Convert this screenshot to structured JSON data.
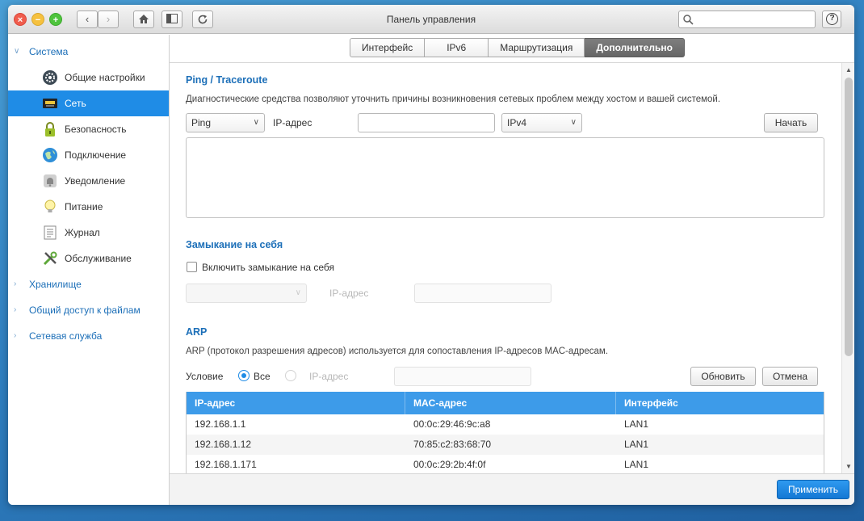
{
  "window": {
    "title": "Панель управления"
  },
  "toolbar": {
    "close_glyph": "×",
    "minimize_glyph": "−",
    "maximize_glyph": "+",
    "back_glyph": "‹",
    "forward_glyph": "›",
    "search_placeholder": "",
    "help_glyph": "?"
  },
  "sidebar": {
    "groups": [
      {
        "label": "Система",
        "expanded": true
      },
      {
        "label": "Хранилище",
        "expanded": false
      },
      {
        "label": "Общий доступ к файлам",
        "expanded": false
      },
      {
        "label": "Сетевая служба",
        "expanded": false
      }
    ],
    "items": [
      {
        "label": "Общие настройки",
        "icon": "settings-gear-icon"
      },
      {
        "label": "Сеть",
        "icon": "network-icon",
        "active": true
      },
      {
        "label": "Безопасность",
        "icon": "lock-icon"
      },
      {
        "label": "Подключение",
        "icon": "globe-icon"
      },
      {
        "label": "Уведомление",
        "icon": "bell-icon"
      },
      {
        "label": "Питание",
        "icon": "lightbulb-icon"
      },
      {
        "label": "Журнал",
        "icon": "log-icon"
      },
      {
        "label": "Обслуживание",
        "icon": "tools-icon"
      }
    ]
  },
  "tabs": [
    {
      "label": "Интерфейс"
    },
    {
      "label": "IPv6"
    },
    {
      "label": "Маршрутизация"
    },
    {
      "label": "Дополнительно",
      "active": true
    }
  ],
  "ping": {
    "title": "Ping / Traceroute",
    "description": "Диагностические средства позволяют уточнить причины возникновения сетевых проблем между хостом и вашей системой.",
    "mode_value": "Ping",
    "ip_label": "IP-адрес",
    "ip_value": "",
    "protocol_value": "IPv4",
    "start_label": "Начать",
    "output": ""
  },
  "loopback": {
    "title": "Замыкание на себя",
    "enable_label": "Включить замыкание на себя",
    "enabled": false,
    "interface_value": "",
    "ip_label": "IP-адрес",
    "ip_value": ""
  },
  "arp": {
    "title": "ARP",
    "description": "ARP (протокол разрешения адресов) используется для сопоставления IP-адресов MAC-адресам.",
    "condition_label": "Условие",
    "option_all": "Все",
    "option_ip": "IP-адрес",
    "selected": "all",
    "filter_value": "",
    "refresh_label": "Обновить",
    "cancel_label": "Отмена",
    "columns": [
      "IP-адрес",
      "MAC-адрес",
      "Интерфейс"
    ],
    "rows": [
      [
        "192.168.1.1",
        "00:0c:29:46:9c:a8",
        "LAN1"
      ],
      [
        "192.168.1.12",
        "70:85:c2:83:68:70",
        "LAN1"
      ],
      [
        "192.168.1.171",
        "00:0c:29:2b:4f:0f",
        "LAN1"
      ]
    ]
  },
  "footer": {
    "apply_label": "Применить"
  },
  "colors": {
    "accent": "#1f8ce6",
    "table_header": "#3d9be9",
    "section_title": "#1c6fb8"
  }
}
